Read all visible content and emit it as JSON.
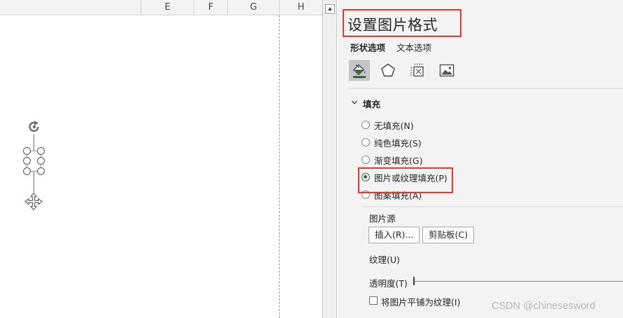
{
  "sheet": {
    "columns": [
      "E",
      "F",
      "G",
      "H"
    ]
  },
  "pane": {
    "title": "设置图片格式",
    "tabs": {
      "shape_options": "形状选项",
      "text_options": "文本选项"
    },
    "icons": [
      "fill-line-icon",
      "effects-pentagon-icon",
      "size-properties-icon",
      "picture-icon"
    ],
    "fill_section": {
      "title": "填充",
      "options": [
        {
          "label": "无填充(N)",
          "checked": false
        },
        {
          "label": "纯色填充(S)",
          "checked": false
        },
        {
          "label": "渐变填充(G)",
          "checked": false
        },
        {
          "label": "图片或纹理填充(P)",
          "checked": true
        },
        {
          "label": "图案填充(A)",
          "checked": false
        }
      ],
      "picture_source_label": "图片源",
      "insert_button": "插入(R)...",
      "clipboard_button": "剪贴板(C)",
      "texture_label": "纹理(U)",
      "transparency_label": "透明度(T)",
      "transparency_value": 0,
      "tile_checkbox_label": "将图片平铺为纹理(I)",
      "tile_checked": false
    },
    "colors": {
      "highlight_box": "#e8382d",
      "radio_checked": "#2b6e41"
    }
  },
  "watermark": "CSDN @chinesesword"
}
